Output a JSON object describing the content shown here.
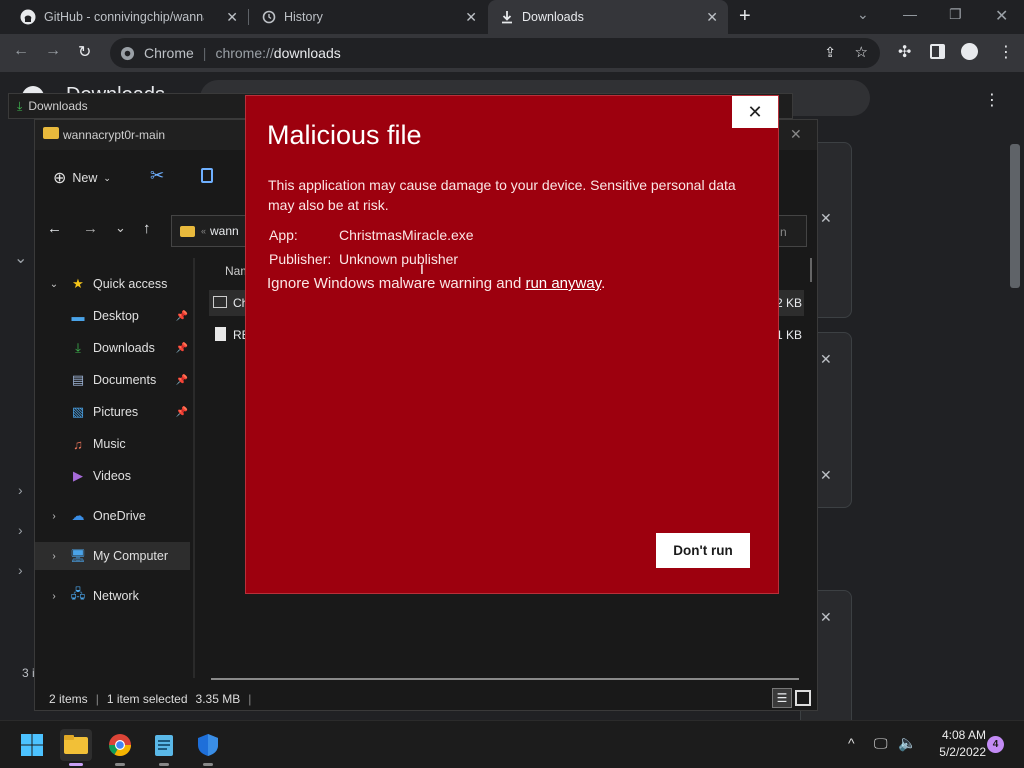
{
  "browser": {
    "tabs": [
      {
        "label": "GitHub - connivingchip/wannacr",
        "icon": "github-icon"
      },
      {
        "label": "History",
        "icon": "history-icon"
      },
      {
        "label": "Downloads",
        "icon": "download-icon",
        "active": true
      }
    ],
    "omnibox_site": "Chrome",
    "omnibox_url_prefix": "chrome://",
    "omnibox_url_path": "downloads"
  },
  "downloads_page": {
    "title": "Downloads",
    "count_fragment": "3 i"
  },
  "explorer": {
    "window_title": "wannacrypt0r-main",
    "new_label": "New",
    "address_fragment": "wann",
    "search_fragment": "n",
    "column_name": "Nam",
    "files": [
      {
        "name": "Ch",
        "size": "2 KB"
      },
      {
        "name": "RE",
        "size": "1 KB"
      }
    ],
    "nav": {
      "quick_access": "Quick access",
      "desktop": "Desktop",
      "downloads": "Downloads",
      "documents": "Documents",
      "pictures": "Pictures",
      "music": "Music",
      "videos": "Videos",
      "onedrive": "OneDrive",
      "my_computer": "My Computer",
      "network": "Network"
    },
    "status": {
      "items": "2 items",
      "selected": "1 item selected",
      "size": "3.35 MB"
    }
  },
  "dialog": {
    "title": "Malicious file",
    "description": "This application may cause damage to your device. Sensitive personal data may also be at risk.",
    "app_label": "App:",
    "app_value": "ChristmasMiracle.exe",
    "publisher_label": "Publisher:",
    "publisher_value": "Unknown publisher",
    "ignore_prefix": "Ignore Windows malware warning and ",
    "run_anyway": "run anyway",
    "ignore_suffix": ".",
    "dont_run": "Don't run",
    "close": "✕"
  },
  "taskbar": {
    "time": "4:08 AM",
    "date": "5/2/2022",
    "notification_count": "4"
  },
  "colors": {
    "dialog_bg": "#9d000e",
    "chrome_dark": "#202124",
    "accent_badge": "#c38bf5"
  }
}
